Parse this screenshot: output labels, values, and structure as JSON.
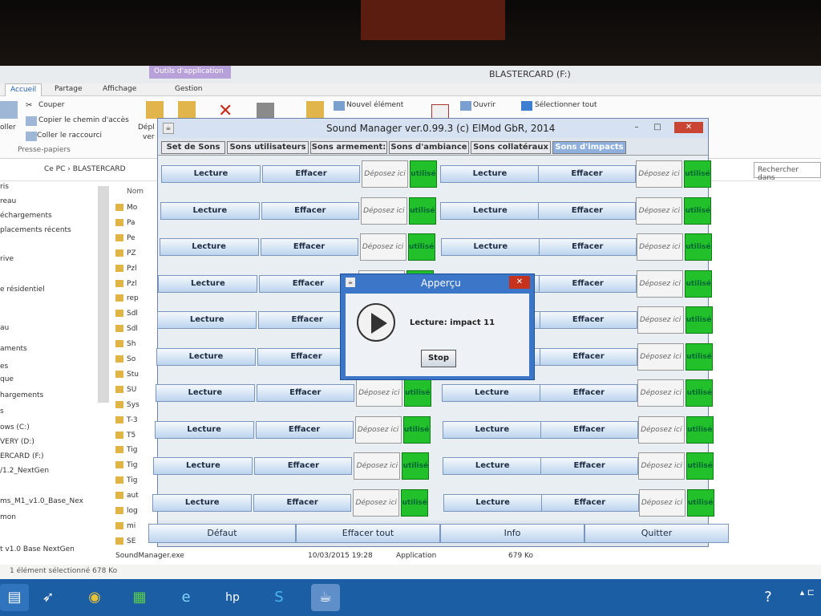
{
  "explorer": {
    "contextual_tab": "Outils d'application",
    "window_title": "BLASTERCARD (F:)",
    "ribbon_tabs": [
      "Accueil",
      "Partage",
      "Affichage",
      "Gestion"
    ],
    "ribbon": {
      "cut": "Couper",
      "copy_path": "Copier le chemin d'accès",
      "paste_shortcut": "Coller le raccourci",
      "paste": "oller",
      "clipboard_group": "Presse-papiers",
      "move": "Dépl",
      "move2": "ver",
      "new_item": "Nouvel élément",
      "open": "Ouvrir",
      "select_all": "Sélectionner tout"
    },
    "address_path": "Ce PC  ›  BLASTERCARD",
    "search_placeholder": "Rechercher dans",
    "nav_items": [
      "ris",
      "reau",
      "échargements",
      "placements récents",
      "rive",
      "e résidentiel",
      "au",
      "aments",
      "es",
      "que",
      "hargements",
      "s",
      "ows (C:)",
      "VERY (D:)",
      "ERCARD (F:)",
      "/1.2_NextGen",
      "ms_M1_v1.0_Base_Nex",
      "mon",
      "t v1.0 Base NextGen"
    ],
    "column_name": "Nom",
    "files": [
      "Mo",
      "Pa",
      "Pe",
      "PZ",
      "Pzl",
      "Pzl",
      "rep",
      "Sdl",
      "Sdl",
      "Sh",
      "So",
      "Stu",
      "SU",
      "Sys",
      "T-3",
      "T5",
      "Tig",
      "Tig",
      "Tig",
      "aut",
      "log",
      "mi",
      "SE"
    ],
    "selected_file": "SoundManager.exe",
    "selected_date": "10/03/2015 19:28",
    "selected_type": "Application",
    "selected_size": "679 Ko",
    "status": "1 élément sélectionné  678 Ko"
  },
  "soundmanager": {
    "title": "Sound Manager ver.0.99.3 (c) ElMod GbR, 2014",
    "tabs": [
      "Set de Sons",
      "Sons utilisateurs",
      "Sons armement:",
      "Sons d'ambiance",
      "Sons collatéraux",
      "Sons d'impacts"
    ],
    "active_tab": "Sons d'impacts",
    "slot_labels": {
      "play": "Lecture",
      "delete": "Effacer",
      "drop": "Déposez ici",
      "used": "utilisé"
    },
    "rows": 10,
    "bottom_buttons": [
      "Défaut",
      "Effacer tout",
      "Info",
      "Quitter"
    ]
  },
  "dialog": {
    "title": "Apperçu",
    "message": "Lecture: impact 11",
    "stop_label": "Stop"
  },
  "colors": {
    "used_green": "#22c12c",
    "tab_selected": "#8fb0dc",
    "dialog_blue": "#3c76c9",
    "taskbar": "#1c5ea3"
  }
}
